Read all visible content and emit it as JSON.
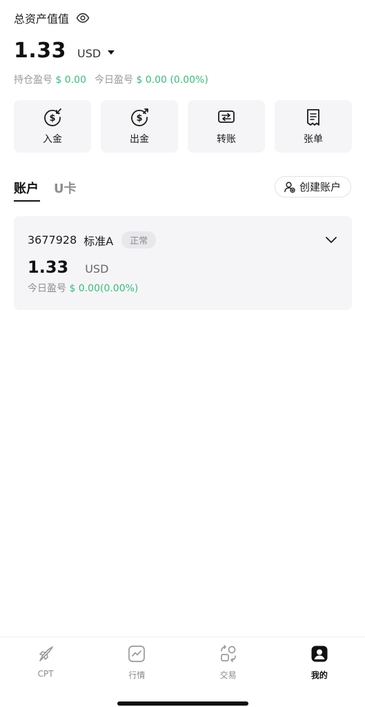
{
  "header": {
    "title": "总资产值值",
    "balance": "1.33",
    "currency": "USD",
    "position_pnl_label": "持仓盈号",
    "position_pnl_value": "$ 0.00",
    "today_pnl_label": "今日盈号",
    "today_pnl_value": "$ 0.00 (0.00%)"
  },
  "actions": [
    {
      "label": "入金",
      "icon": "deposit-icon"
    },
    {
      "label": "出金",
      "icon": "withdraw-icon"
    },
    {
      "label": "转账",
      "icon": "transfer-icon"
    },
    {
      "label": "张单",
      "icon": "bill-icon"
    }
  ],
  "tabs": {
    "account": "账户",
    "ucard": "U卡",
    "create_label": "创建账户"
  },
  "account_card": {
    "number": "3677928",
    "type": "标准A",
    "status": "正常",
    "amount": "1.33",
    "currency": "USD",
    "today_label": "今日盈号",
    "today_value": "$ 0.00(0.00%)"
  },
  "bottom_nav": [
    {
      "label": "CPT",
      "icon": "rocket-icon",
      "active": false
    },
    {
      "label": "行情",
      "icon": "chart-icon",
      "active": false
    },
    {
      "label": "交易",
      "icon": "trade-icon",
      "active": false
    },
    {
      "label": "我的",
      "icon": "profile-icon",
      "active": true
    }
  ],
  "colors": {
    "accent_green": "#3cb97a",
    "card_bg": "#f5f5f7",
    "text_primary": "#111111"
  }
}
